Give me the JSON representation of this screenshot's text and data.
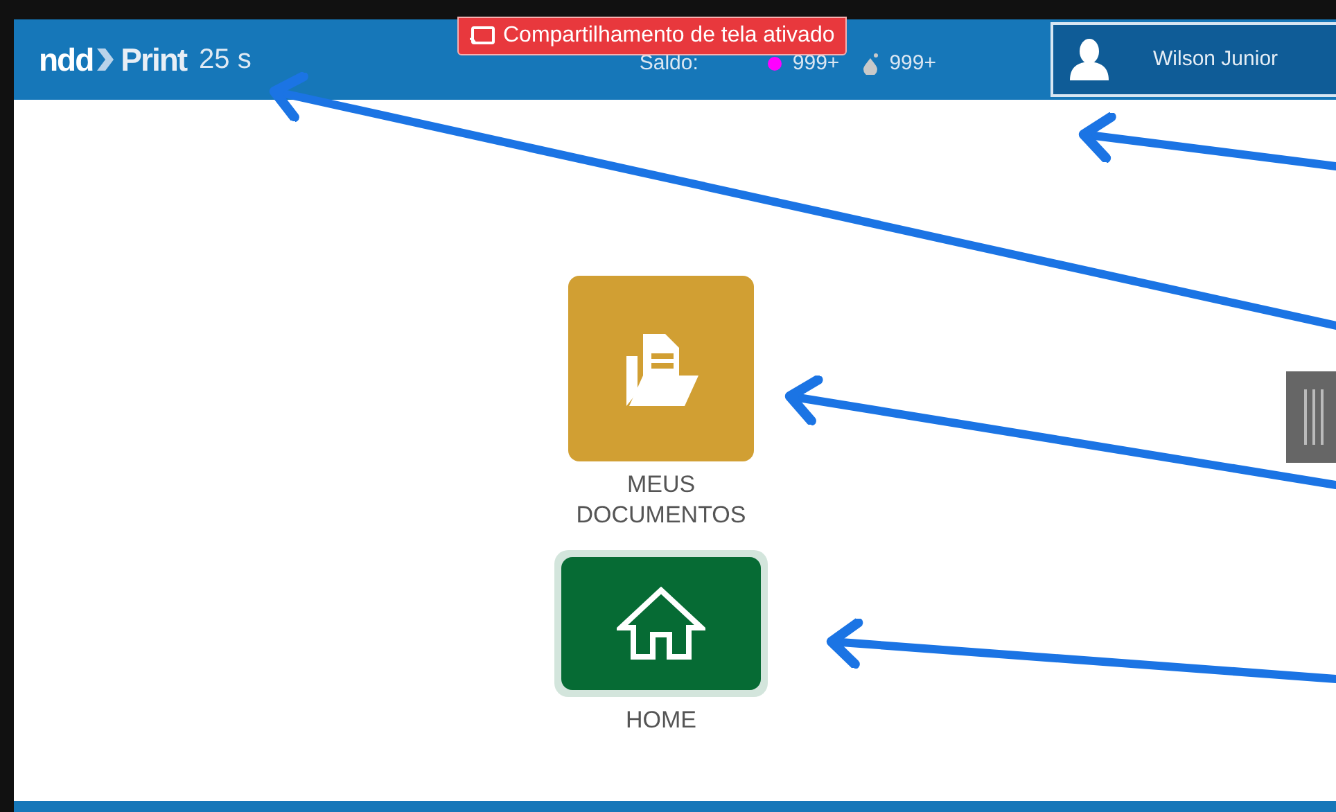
{
  "header": {
    "logo": {
      "left": "ndd",
      "right": "Print"
    },
    "timer": "25 s",
    "balance": {
      "label": "Saldo:",
      "items": [
        {
          "kind": "color",
          "color": "#ff00ff",
          "value": "999+"
        },
        {
          "kind": "mono",
          "value": "999+"
        }
      ]
    },
    "user": {
      "name": "Wilson Junior"
    }
  },
  "banner": {
    "text": "Compartilhamento de tela ativado"
  },
  "tiles": [
    {
      "kind": "documents",
      "label": "MEUS DOCUMENTOS",
      "color": "#d19f33",
      "selected": false
    },
    {
      "kind": "home",
      "label": "HOME",
      "color": "#066b34",
      "selected": true
    }
  ]
}
